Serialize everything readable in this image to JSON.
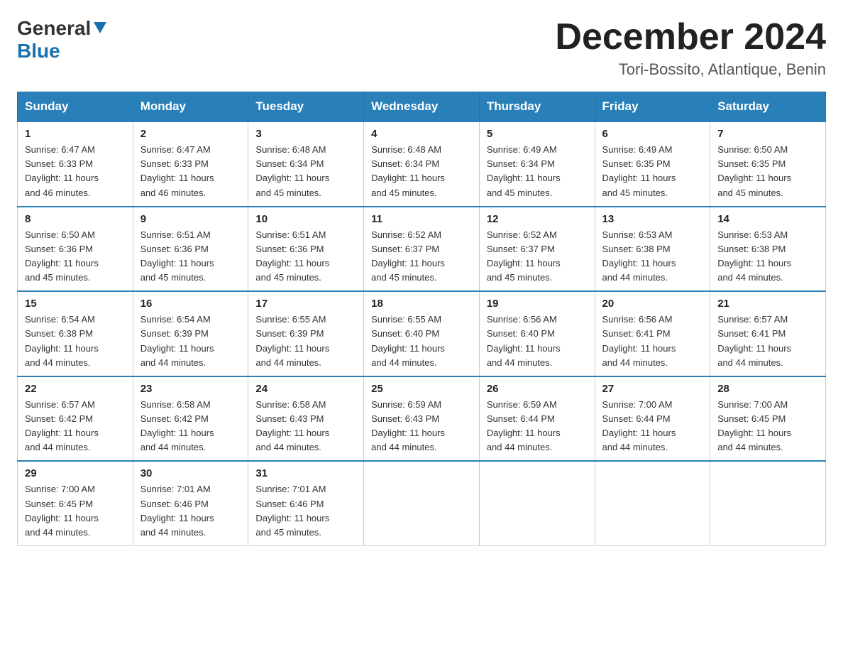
{
  "header": {
    "logo_general": "General",
    "logo_blue": "Blue",
    "month_title": "December 2024",
    "subtitle": "Tori-Bossito, Atlantique, Benin"
  },
  "weekdays": [
    "Sunday",
    "Monday",
    "Tuesday",
    "Wednesday",
    "Thursday",
    "Friday",
    "Saturday"
  ],
  "weeks": [
    [
      {
        "day": "1",
        "sunrise": "6:47 AM",
        "sunset": "6:33 PM",
        "daylight": "11 hours and 46 minutes."
      },
      {
        "day": "2",
        "sunrise": "6:47 AM",
        "sunset": "6:33 PM",
        "daylight": "11 hours and 46 minutes."
      },
      {
        "day": "3",
        "sunrise": "6:48 AM",
        "sunset": "6:34 PM",
        "daylight": "11 hours and 45 minutes."
      },
      {
        "day": "4",
        "sunrise": "6:48 AM",
        "sunset": "6:34 PM",
        "daylight": "11 hours and 45 minutes."
      },
      {
        "day": "5",
        "sunrise": "6:49 AM",
        "sunset": "6:34 PM",
        "daylight": "11 hours and 45 minutes."
      },
      {
        "day": "6",
        "sunrise": "6:49 AM",
        "sunset": "6:35 PM",
        "daylight": "11 hours and 45 minutes."
      },
      {
        "day": "7",
        "sunrise": "6:50 AM",
        "sunset": "6:35 PM",
        "daylight": "11 hours and 45 minutes."
      }
    ],
    [
      {
        "day": "8",
        "sunrise": "6:50 AM",
        "sunset": "6:36 PM",
        "daylight": "11 hours and 45 minutes."
      },
      {
        "day": "9",
        "sunrise": "6:51 AM",
        "sunset": "6:36 PM",
        "daylight": "11 hours and 45 minutes."
      },
      {
        "day": "10",
        "sunrise": "6:51 AM",
        "sunset": "6:36 PM",
        "daylight": "11 hours and 45 minutes."
      },
      {
        "day": "11",
        "sunrise": "6:52 AM",
        "sunset": "6:37 PM",
        "daylight": "11 hours and 45 minutes."
      },
      {
        "day": "12",
        "sunrise": "6:52 AM",
        "sunset": "6:37 PM",
        "daylight": "11 hours and 45 minutes."
      },
      {
        "day": "13",
        "sunrise": "6:53 AM",
        "sunset": "6:38 PM",
        "daylight": "11 hours and 44 minutes."
      },
      {
        "day": "14",
        "sunrise": "6:53 AM",
        "sunset": "6:38 PM",
        "daylight": "11 hours and 44 minutes."
      }
    ],
    [
      {
        "day": "15",
        "sunrise": "6:54 AM",
        "sunset": "6:38 PM",
        "daylight": "11 hours and 44 minutes."
      },
      {
        "day": "16",
        "sunrise": "6:54 AM",
        "sunset": "6:39 PM",
        "daylight": "11 hours and 44 minutes."
      },
      {
        "day": "17",
        "sunrise": "6:55 AM",
        "sunset": "6:39 PM",
        "daylight": "11 hours and 44 minutes."
      },
      {
        "day": "18",
        "sunrise": "6:55 AM",
        "sunset": "6:40 PM",
        "daylight": "11 hours and 44 minutes."
      },
      {
        "day": "19",
        "sunrise": "6:56 AM",
        "sunset": "6:40 PM",
        "daylight": "11 hours and 44 minutes."
      },
      {
        "day": "20",
        "sunrise": "6:56 AM",
        "sunset": "6:41 PM",
        "daylight": "11 hours and 44 minutes."
      },
      {
        "day": "21",
        "sunrise": "6:57 AM",
        "sunset": "6:41 PM",
        "daylight": "11 hours and 44 minutes."
      }
    ],
    [
      {
        "day": "22",
        "sunrise": "6:57 AM",
        "sunset": "6:42 PM",
        "daylight": "11 hours and 44 minutes."
      },
      {
        "day": "23",
        "sunrise": "6:58 AM",
        "sunset": "6:42 PM",
        "daylight": "11 hours and 44 minutes."
      },
      {
        "day": "24",
        "sunrise": "6:58 AM",
        "sunset": "6:43 PM",
        "daylight": "11 hours and 44 minutes."
      },
      {
        "day": "25",
        "sunrise": "6:59 AM",
        "sunset": "6:43 PM",
        "daylight": "11 hours and 44 minutes."
      },
      {
        "day": "26",
        "sunrise": "6:59 AM",
        "sunset": "6:44 PM",
        "daylight": "11 hours and 44 minutes."
      },
      {
        "day": "27",
        "sunrise": "7:00 AM",
        "sunset": "6:44 PM",
        "daylight": "11 hours and 44 minutes."
      },
      {
        "day": "28",
        "sunrise": "7:00 AM",
        "sunset": "6:45 PM",
        "daylight": "11 hours and 44 minutes."
      }
    ],
    [
      {
        "day": "29",
        "sunrise": "7:00 AM",
        "sunset": "6:45 PM",
        "daylight": "11 hours and 44 minutes."
      },
      {
        "day": "30",
        "sunrise": "7:01 AM",
        "sunset": "6:46 PM",
        "daylight": "11 hours and 44 minutes."
      },
      {
        "day": "31",
        "sunrise": "7:01 AM",
        "sunset": "6:46 PM",
        "daylight": "11 hours and 45 minutes."
      },
      null,
      null,
      null,
      null
    ]
  ],
  "labels": {
    "sunrise": "Sunrise:",
    "sunset": "Sunset:",
    "daylight": "Daylight:"
  }
}
